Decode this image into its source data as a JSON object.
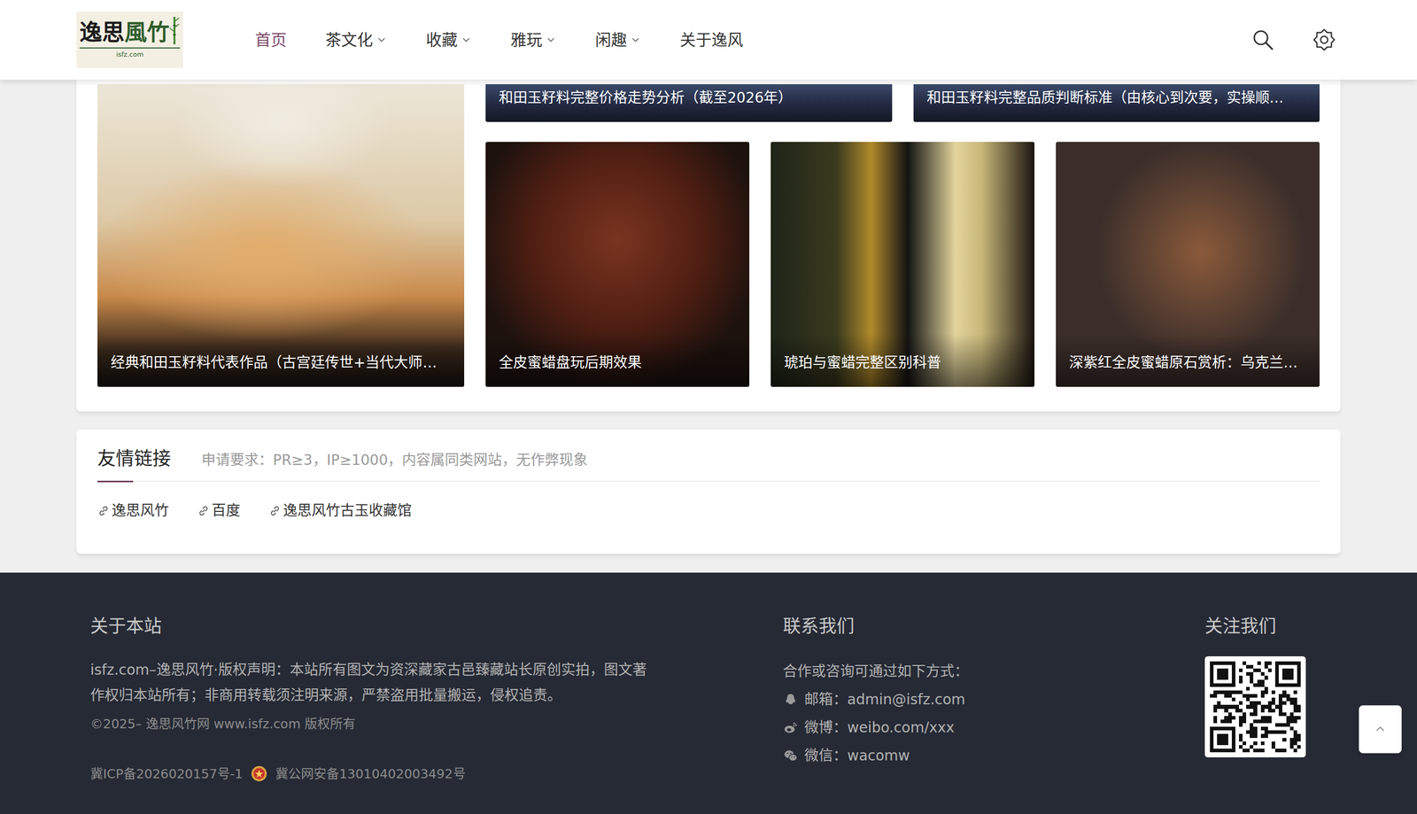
{
  "logo": {
    "main": "逸思",
    "accent": "風竹",
    "domain": "isfz.com"
  },
  "nav": [
    {
      "label": "首页",
      "selected": true,
      "dropdown": false
    },
    {
      "label": "茶文化",
      "selected": false,
      "dropdown": true
    },
    {
      "label": "收藏",
      "selected": false,
      "dropdown": true
    },
    {
      "label": "雅玩",
      "selected": false,
      "dropdown": true
    },
    {
      "label": "闲趣",
      "selected": false,
      "dropdown": true
    },
    {
      "label": "关于逸风",
      "selected": false,
      "dropdown": false
    }
  ],
  "featured": {
    "main": {
      "title": "经典和田玉籽料代表作品（古宫廷传世+当代大师…"
    },
    "top": [
      {
        "title": "和田玉籽料完整价格走势分析（截至2026年）"
      },
      {
        "title": "和田玉籽料完整品质判断标准（由核心到次要，实操顺…"
      }
    ],
    "bottom": [
      {
        "title": "全皮蜜蜡盘玩后期效果"
      },
      {
        "title": "琥珀与蜜蜡完整区别科普"
      },
      {
        "title": "深紫红全皮蜜蜡原石赏析：乌克兰…"
      }
    ]
  },
  "links": {
    "title": "友情链接",
    "note": "申请要求：PR≥3，IP≥1000，内容属同类网站，无作弊现象",
    "items": [
      "逸思风竹",
      "百度",
      "逸思风竹古玉收藏馆"
    ]
  },
  "footer": {
    "about": {
      "title": "关于本站",
      "text": "isfz.com–逸思风竹·版权声明：本站所有图文为资深藏家古邑臻藏站长原创实拍，图文著作权归本站所有；非商用转载须注明来源，严禁盗用批量搬运，侵权追责。",
      "copyright": "©2025– 逸思风竹网 www.isfz.com 版权所有",
      "icp": "冀ICP备2026020157号-1",
      "police": "冀公网安备13010402003492号"
    },
    "contact": {
      "title": "联系我们",
      "intro": "合作或咨询可通过如下方式：",
      "items": [
        {
          "kind": "qq",
          "text": "邮箱：admin@isfz.com"
        },
        {
          "kind": "weibo",
          "text": "微博：weibo.com/xxx"
        },
        {
          "kind": "wechat",
          "text": "微信：wacomw"
        }
      ]
    },
    "follow": {
      "title": "关注我们"
    }
  }
}
